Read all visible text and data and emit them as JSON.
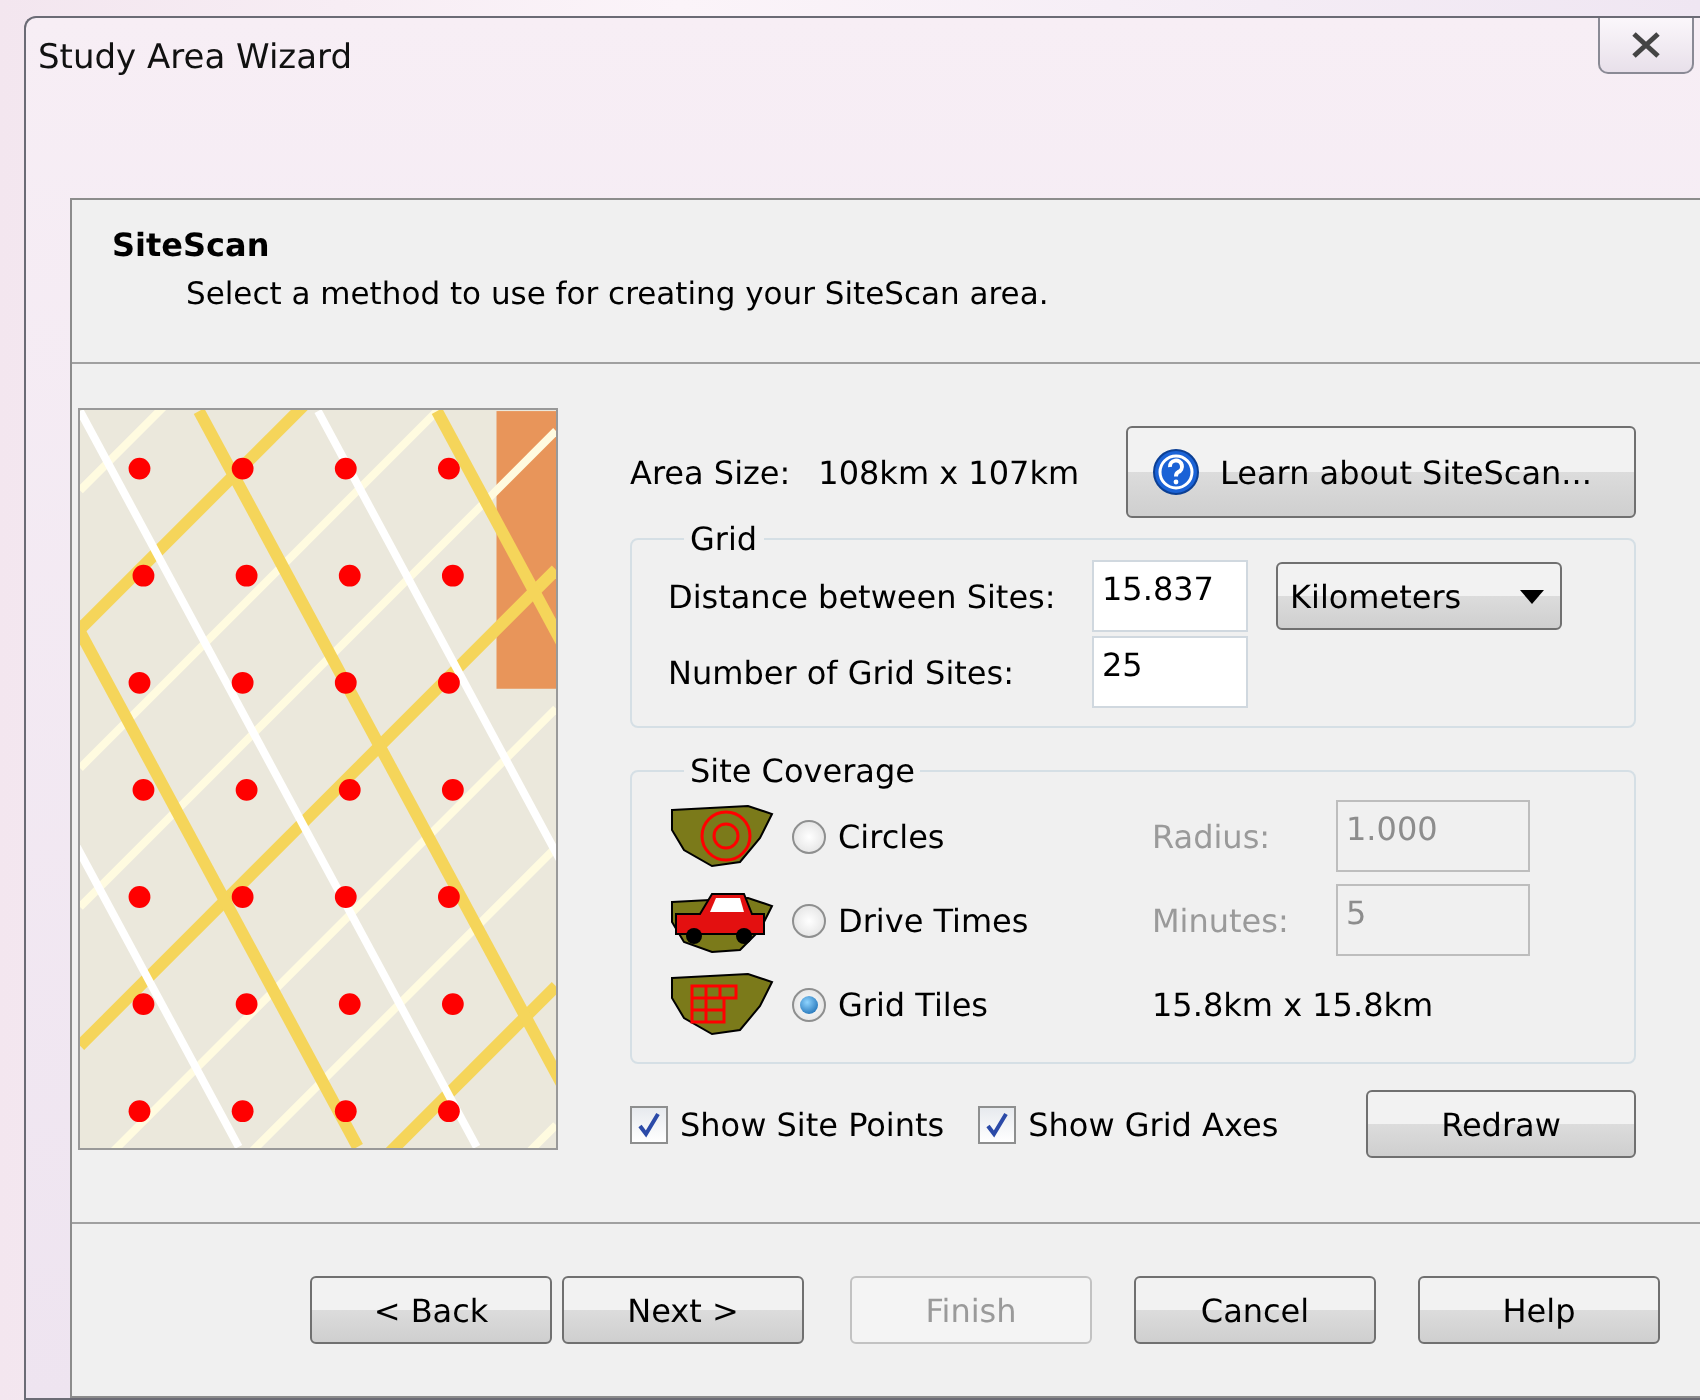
{
  "window": {
    "title": "Study Area Wizard"
  },
  "header": {
    "title": "SiteScan",
    "subtitle": "Select a method to use for creating your SiteScan area."
  },
  "area_size": {
    "label": "Area Size:",
    "value": "108km x 107km"
  },
  "learn_button": {
    "label": "Learn about SiteScan..."
  },
  "grid": {
    "title": "Grid",
    "distance_label": "Distance between Sites:",
    "distance_value": "15.837",
    "unit": "Kilometers",
    "count_label": "Number of Grid Sites:",
    "count_value": "25"
  },
  "site_coverage": {
    "title": "Site Coverage",
    "options": [
      {
        "kind": "circles",
        "label": "Circles",
        "selected": false,
        "field_label": "Radius:",
        "field_value": "1.000",
        "disabled": true
      },
      {
        "kind": "drive",
        "label": "Drive Times",
        "selected": false,
        "field_label": "Minutes:",
        "field_value": "5",
        "disabled": true
      },
      {
        "kind": "tiles",
        "label": "Grid Tiles",
        "selected": true,
        "note": "15.8km x 15.8km"
      }
    ]
  },
  "checkboxes": [
    {
      "label": "Show Site Points",
      "checked": true
    },
    {
      "label": "Show Grid Axes",
      "checked": true
    }
  ],
  "redraw_button": {
    "label": "Redraw"
  },
  "footer_buttons": [
    {
      "label": "< Back",
      "disabled": false
    },
    {
      "label": "Next >",
      "disabled": false
    },
    {
      "label": "Finish",
      "disabled": true
    },
    {
      "label": "Cancel",
      "disabled": false
    },
    {
      "label": "Help",
      "disabled": false
    }
  ]
}
